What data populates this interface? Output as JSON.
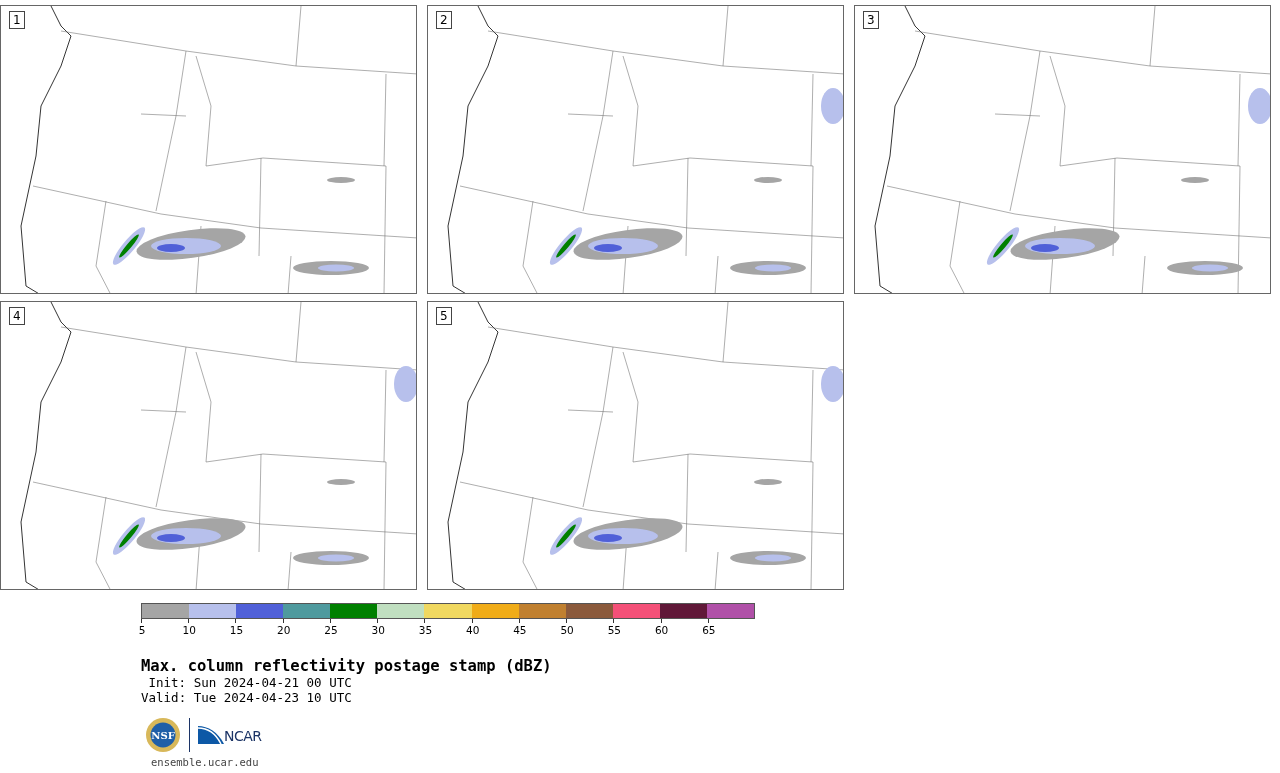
{
  "panels": [
    {
      "number": "1"
    },
    {
      "number": "2"
    },
    {
      "number": "3"
    },
    {
      "number": "4"
    },
    {
      "number": "5"
    }
  ],
  "colorbar": {
    "segments": [
      {
        "color": "#a5a5a5"
      },
      {
        "color": "#b7c0ec"
      },
      {
        "color": "#5060d8"
      },
      {
        "color": "#4f9a9e"
      },
      {
        "color": "#008000"
      },
      {
        "color": "#c0dfc0"
      },
      {
        "color": "#f0d860"
      },
      {
        "color": "#f0ac18"
      },
      {
        "color": "#c08030"
      },
      {
        "color": "#8b5a3c"
      },
      {
        "color": "#f45078"
      },
      {
        "color": "#601838"
      },
      {
        "color": "#b050a8"
      }
    ],
    "ticks": [
      "5",
      "10",
      "15",
      "20",
      "25",
      "30",
      "35",
      "40",
      "45",
      "50",
      "55",
      "60",
      "65"
    ]
  },
  "title": "Max. column reflectivity postage stamp (dBZ)",
  "init": "Init: Sun 2024-04-21 00 UTC",
  "valid": "Valid: Tue 2024-04-23 10 UTC",
  "logos": {
    "left": "NSF",
    "right": "NCAR"
  },
  "footer": "ensemble.ucar.edu"
}
